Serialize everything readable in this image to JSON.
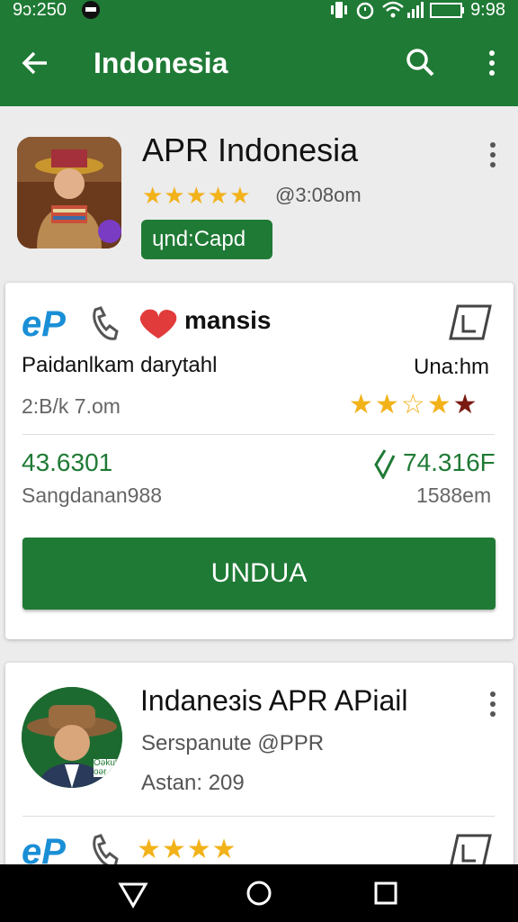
{
  "status_bar": {
    "time_left": "9ɔ:250",
    "time_right": "9:98"
  },
  "toolbar": {
    "title": "Indonesia"
  },
  "header": {
    "title": "APR Indonesia",
    "stars": "★★★★★",
    "date": "@3:08om",
    "pill": "ɥnd:Capd"
  },
  "card1": {
    "brand_a": "eP",
    "brand_b": "mansis",
    "line1_left": "Paidanlkam darytahl",
    "line1_right": "Una:hm",
    "meta_left": "2:B/k 7.om",
    "value_left": "43.6301",
    "value_right": "74.316F",
    "caption_left": "Sangdanan988",
    "caption_right": "1588em",
    "button": "UNDUA",
    "rating_stars": "★★☆★★"
  },
  "card2": {
    "title": "Indaneɜis APR APiail",
    "subtitle": "Serspanute @PPR",
    "meta": "Astan: 209",
    "avatar_badge": "Oəkub oər",
    "brand_a": "eP",
    "stars": "★★★★"
  },
  "colors": {
    "primary": "#1f7a35",
    "star": "#f2b21a",
    "dark_star": "#7a1a12",
    "brand_blue": "#1a8fd6",
    "brand_red": "#e23b3b"
  }
}
